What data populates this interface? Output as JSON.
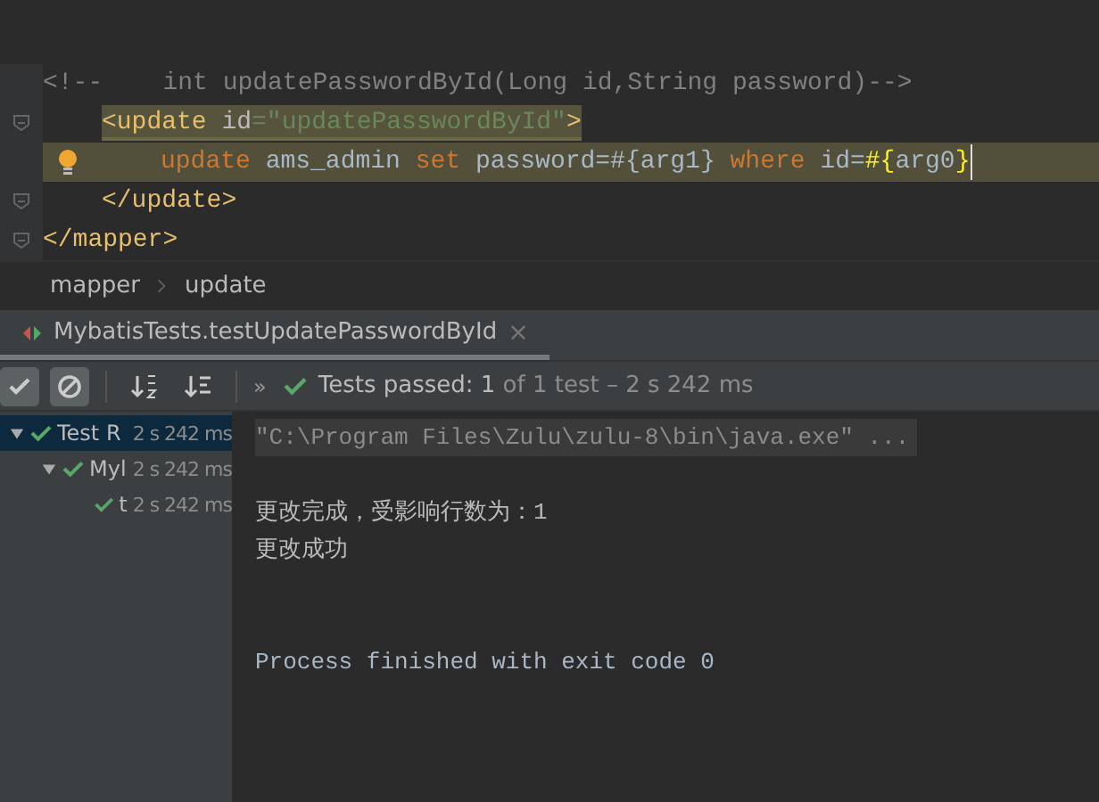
{
  "editor": {
    "lines": [
      {
        "fold": false,
        "bulb": false,
        "highlighted": false,
        "current": false,
        "tokens": [
          {
            "text": "<!--    int updatePasswordById(Long id,String password)-->",
            "kind": "comment"
          }
        ]
      },
      {
        "children": [
          {
            "fold": true,
            "bulb": false,
            "highlighted": true,
            "current": false,
            "tokens": [
              {
                "text": "<update ",
                "kind": "tag"
              },
              {
                "text": "id",
                "kind": "attr"
              },
              {
                "text": "=\"updatePasswordById\"",
                "kind": "string"
              },
              {
                "text": ">",
                "kind": "tag"
              }
            ]
          },
          {
            "children": [
              {
                "fold": false,
                "bulb": true,
                "highlighted": false,
                "current": true,
                "tokens": [
                  {
                    "text": "update ",
                    "kind": "keyword"
                  },
                  {
                    "text": "ams_admin ",
                    "kind": "plain"
                  },
                  {
                    "text": "set ",
                    "kind": "keyword"
                  },
                  {
                    "text": "password=#{arg1} ",
                    "kind": "plain"
                  },
                  {
                    "text": "where ",
                    "kind": "keyword"
                  },
                  {
                    "text": "id=",
                    "kind": "plain"
                  },
                  {
                    "text": "#{",
                    "kind": "param"
                  },
                  {
                    "text": "arg0",
                    "kind": "plain"
                  },
                  {
                    "text": "}",
                    "kind": "param"
                  }
                ]
              }
            ]
          },
          {
            "fold": true,
            "bulb": false,
            "highlighted": false,
            "current": false,
            "tokens": [
              {
                "text": "</update>",
                "kind": "tag"
              }
            ]
          }
        ]
      },
      {
        "fold": true,
        "bulb": false,
        "highlighted": false,
        "current": false,
        "tokens": [
          {
            "text": "</mapper>",
            "kind": "tag"
          }
        ]
      }
    ]
  },
  "breadcrumbs": [
    "mapper",
    "update"
  ],
  "run_tab": {
    "title": "MybatisTests.testUpdatePasswordById",
    "close": "×"
  },
  "toolbar": {
    "more": "»",
    "status_label": "Tests passed:",
    "status_count": "1",
    "status_rest": "of 1 test – 2 s 242 ms"
  },
  "tree": [
    {
      "label": "Test R",
      "time": "2 s 242 ms",
      "selected": true,
      "expanded": true,
      "children": [
        {
          "label": "Myl",
          "time": "2 s 242 ms",
          "selected": false,
          "expanded": true,
          "children": [
            {
              "label": "t",
              "time": "2 s 242 ms",
              "selected": false
            }
          ]
        }
      ]
    }
  ],
  "console": [
    {
      "text": "\"C:\\Program Files\\Zulu\\zulu-8\\bin\\java.exe\" ...",
      "kind": "command"
    },
    {
      "kind": "blank"
    },
    {
      "text": "更改完成，受影响行数为：1",
      "kind": "output"
    },
    {
      "text": "更改成功",
      "kind": "output"
    },
    {
      "kind": "blank"
    },
    {
      "kind": "blank"
    },
    {
      "text": "Process finished with exit code 0",
      "kind": "exit"
    }
  ]
}
